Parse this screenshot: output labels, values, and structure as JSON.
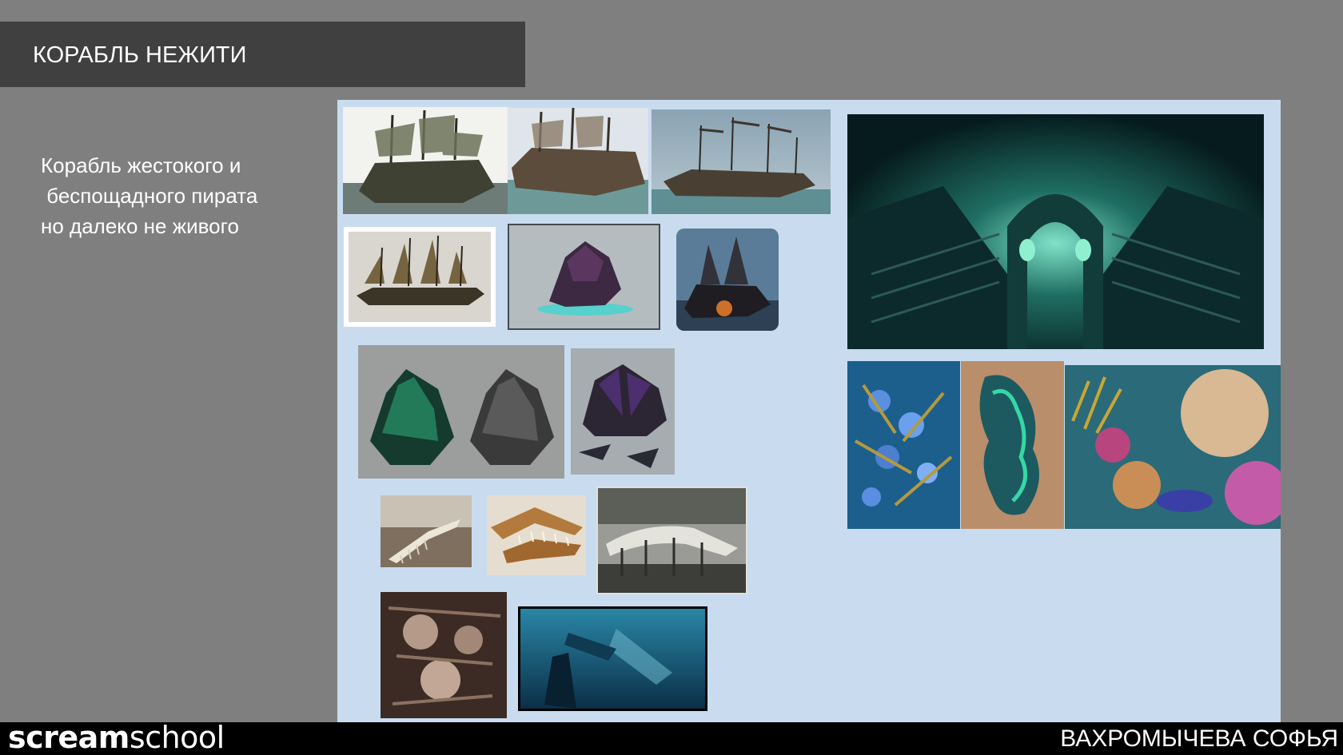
{
  "slide": {
    "title": "КОРАБЛЬ НЕЖИТИ",
    "description_lines": [
      "Корабль жестокого и",
      " беспощадного пирата",
      "но далеко не живого"
    ]
  },
  "footer": {
    "logo_bold": "scream",
    "logo_light": "school",
    "author": "ВАХРОМЫЧЕВА СОФЬЯ"
  },
  "colors": {
    "background": "#7f7f7f",
    "title_bar": "#404040",
    "board": "#c9dcef",
    "footer": "#000000"
  },
  "moodboard": {
    "images": [
      "ghost-ship-photo",
      "wrecked-galleon-photo",
      "galleon-at-sea-photo",
      "torn-sails-ship-sketch",
      "purple-ghost-ship-render",
      "burning-ship-art",
      "green-glowing-ship-concept",
      "purple-sail-ship-concept",
      "whale-skeleton-museum",
      "fish-skull-jaws",
      "whale-skeleton-outdoor",
      "carved-skull-relief",
      "underwater-wreck-scene",
      "ghost-ship-deck-gate",
      "coral-polyps",
      "giant-clam",
      "coral-reef"
    ]
  }
}
